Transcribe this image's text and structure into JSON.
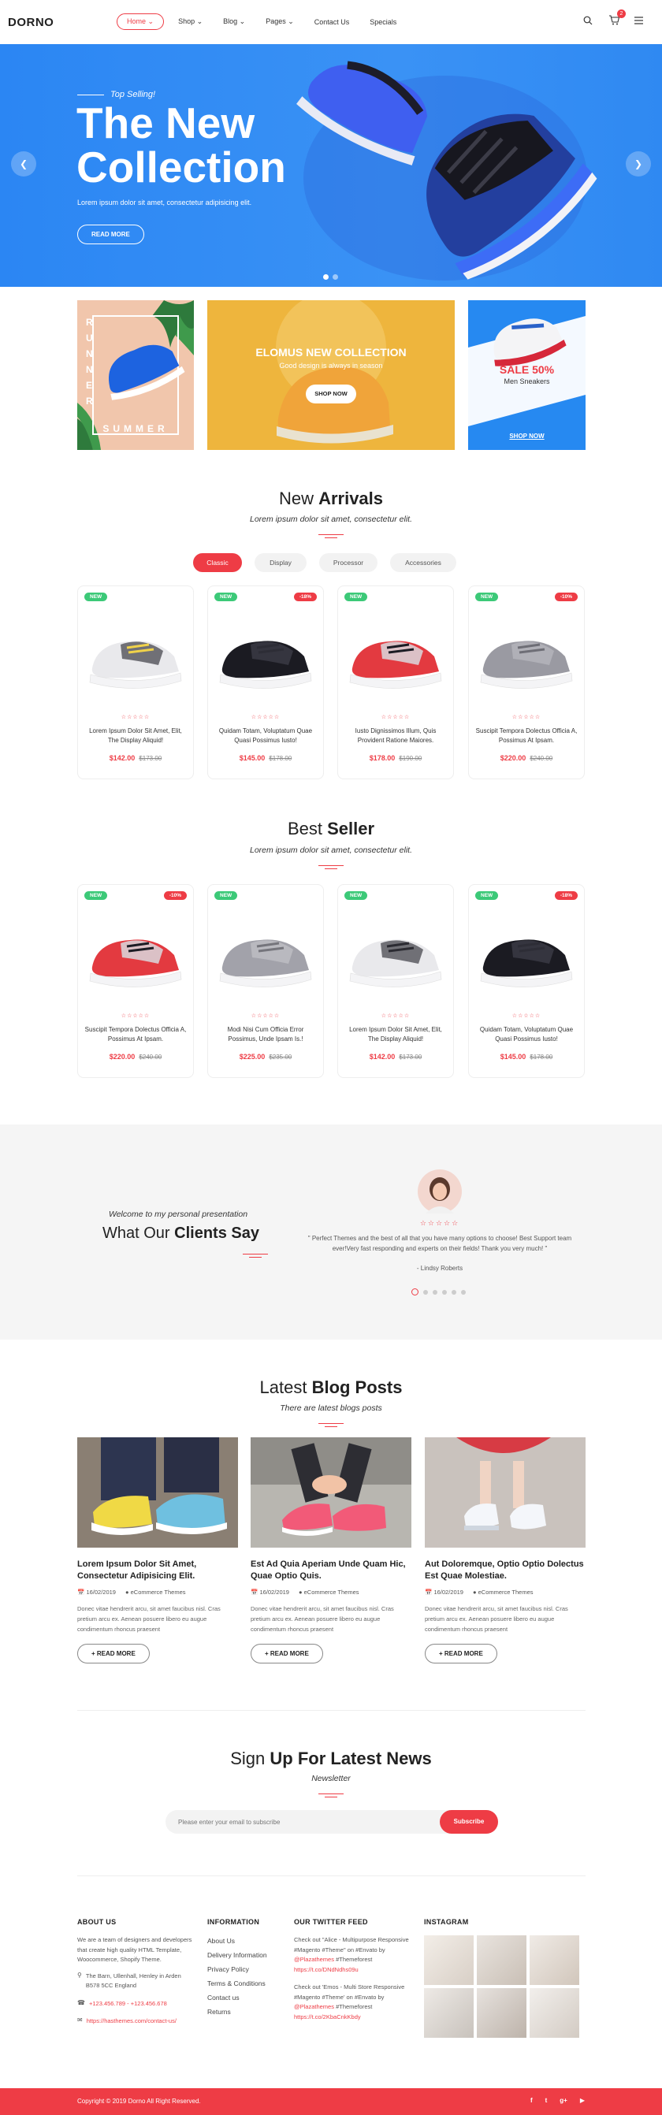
{
  "header": {
    "logo": "DORNO",
    "nav": [
      {
        "label": "Home ⌄"
      },
      {
        "label": "Shop ⌄"
      },
      {
        "label": "Blog ⌄"
      },
      {
        "label": "Pages ⌄"
      },
      {
        "label": "Contact Us"
      },
      {
        "label": "Specials"
      }
    ],
    "cart_count": "2"
  },
  "hero": {
    "subtitle": "Top Selling!",
    "title_line1": "The New",
    "title_line2": "Collection",
    "description": "Lorem ipsum dolor sit amet, consectetur adipisicing elit.",
    "button": "READ MORE"
  },
  "banners": {
    "left_vertical": "RUNNER",
    "left_bottom": "SUMMER",
    "center_title": "ELOMUS NEW COLLECTION",
    "center_sub": "Good design is always in season",
    "center_button": "SHOP NOW",
    "right_sale": "SALE 50%",
    "right_sub": "Men Sneakers",
    "right_button": "SHOP NOW"
  },
  "arrivals": {
    "title_light": "New ",
    "title_bold": "Arrivals",
    "subtitle": "Lorem ipsum dolor sit amet, consectetur elit.",
    "tabs": [
      "Classic",
      "Display",
      "Processor",
      "Accessories"
    ],
    "products": [
      {
        "new": "NEW",
        "sale": "",
        "stars": "☆☆☆☆☆",
        "name": "Lorem Ipsum Dolor Sit Amet, Elit, The Display Aliquid!",
        "price": "$142.00",
        "old": "$173.00"
      },
      {
        "new": "NEW",
        "sale": "-18%",
        "stars": "☆☆☆☆☆",
        "name": "Quidam Totam, Voluptatum Quae Quasi Possimus Iusto!",
        "price": "$145.00",
        "old": "$178.00"
      },
      {
        "new": "NEW",
        "sale": "",
        "stars": "☆☆☆☆☆",
        "name": "Iusto Dignissimos Illum, Quis Provident Ratione Maiores.",
        "price": "$178.00",
        "old": "$190.00"
      },
      {
        "new": "NEW",
        "sale": "-10%",
        "stars": "☆☆☆☆☆",
        "name": "Suscipit Tempora Dolectus Officia A, Possimus At Ipsam.",
        "price": "$220.00",
        "old": "$240.00"
      }
    ]
  },
  "best": {
    "title_light": "Best ",
    "title_bold": "Seller",
    "subtitle": "Lorem ipsum dolor sit amet, consectetur elit.",
    "products": [
      {
        "new": "NEW",
        "sale": "-10%",
        "stars": "☆☆☆☆☆",
        "name": "Suscipit Tempora Dolectus Officia A, Possimus At Ipsam.",
        "price": "$220.00",
        "old": "$240.00"
      },
      {
        "new": "NEW",
        "sale": "",
        "stars": "☆☆☆☆☆",
        "name": "Modi Nisi Cum Officia Error Possimus, Unde Ipsam Is.!",
        "price": "$225.00",
        "old": "$235.00"
      },
      {
        "new": "NEW",
        "sale": "",
        "stars": "☆☆☆☆☆",
        "name": "Lorem Ipsum Dolor Sit Amet, Elit, The Display Aliquid!",
        "price": "$142.00",
        "old": "$173.00"
      },
      {
        "new": "NEW",
        "sale": "-18%",
        "stars": "☆☆☆☆☆",
        "name": "Quidam Totam, Voluptatum Quae Quasi Possimus Iusto!",
        "price": "$145.00",
        "old": "$178.00"
      }
    ]
  },
  "testimonial": {
    "welcome": "Welcome to my personal presentation",
    "title_light": "What Our ",
    "title_bold": "Clients Say",
    "stars": "☆☆☆☆☆",
    "quote": "\" Perfect Themes and the best of all that you have many options to choose! Best Support team ever!Very fast responding and experts on their fields! Thank you very much! \"",
    "author": "- Lindsy Roberts"
  },
  "blog": {
    "title_light": "Latest ",
    "title_bold": "Blog Posts",
    "subtitle": "There are latest blogs posts",
    "posts": [
      {
        "title": "Lorem Ipsum Dolor Sit Amet, Consectetur Adipisicing Elit.",
        "date": "16/02/2019",
        "author": "eCommerce Themes",
        "desc": "Donec vitae hendrerit arcu, sit amet faucibus nisl. Cras pretium arcu ex. Aenean posuere libero eu augue condimentum rhoncus praesent",
        "button": "+ READ MORE"
      },
      {
        "title": "Est Ad Quia Aperiam Unde Quam Hic, Quae Optio Quis.",
        "date": "16/02/2019",
        "author": "eCommerce Themes",
        "desc": "Donec vitae hendrerit arcu, sit amet faucibus nisl. Cras pretium arcu ex. Aenean posuere libero eu augue condimentum rhoncus praesent",
        "button": "+ READ MORE"
      },
      {
        "title": "Aut Doloremque, Optio Optio Dolectus Est Quae Molestiae.",
        "date": "16/02/2019",
        "author": "eCommerce Themes",
        "desc": "Donec vitae hendrerit arcu, sit amet faucibus nisl. Cras pretium arcu ex. Aenean posuere libero eu augue condimentum rhoncus praesent",
        "button": "+ READ MORE"
      }
    ]
  },
  "newsletter": {
    "title_light": "Sign ",
    "title_bold": "Up For Latest News",
    "subtitle": "Newsletter",
    "placeholder": "Please enter your email to subscribe",
    "button": "Subscribe"
  },
  "footer": {
    "about_head": "ABOUT US",
    "about_text": "We are a team of designers and developers that create high quality HTML Template, Woocommerce, Shopify Theme.",
    "address": "The Barn, Ullenhall, Henley in Arden B578 5CC England",
    "phone": "+123.456.789 - +123.456.678",
    "url": "https://hasthemes.com/contact-us/",
    "info_head": "INFORMATION",
    "info_links": [
      "About Us",
      "Delivery Information",
      "Privacy Policy",
      "Terms & Conditions",
      "Contact us",
      "Returns"
    ],
    "twitter_head": "OUR TWITTER FEED",
    "tweet1_a": "Check out \"Alice - Multipurpose Responsive #Magento #Theme\" on #Envato by ",
    "tweet1_handle": "@Plazathemes",
    "tweet1_b": " #Themeforest ",
    "tweet1_link": "https://t.co/DNdNdhs09u",
    "tweet2_a": "Check out 'Emos - Multi Store Responsive #Magento #Theme' on #Envato by ",
    "tweet2_handle": "@Plazathemes",
    "tweet2_b": " #Themeforest ",
    "tweet2_link": "https://t.co/2KbaCnkKbdy",
    "insta_head": "INSTAGRAM",
    "copyright": "Copyright © 2019 Dorno All Right Reserved.",
    "social": [
      "f",
      "t",
      "g+",
      "▶"
    ]
  },
  "colors": {
    "accent": "#ee3c45",
    "hero": "#2f89f2",
    "new_badge": "#3cc978"
  }
}
